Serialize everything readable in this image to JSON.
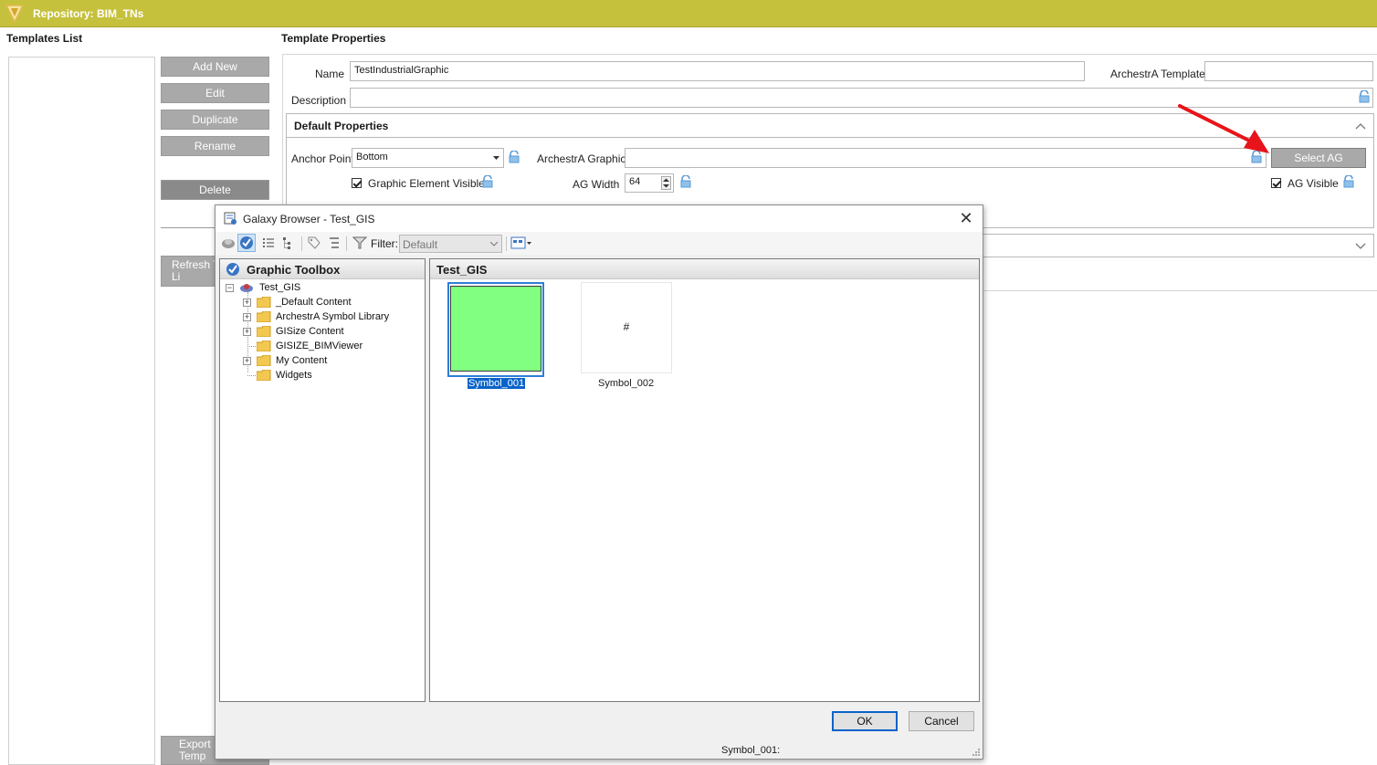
{
  "app": {
    "title": "Repository: BIM_TNs"
  },
  "templates_list": {
    "header": "Templates List",
    "buttons": {
      "add_new": "Add New",
      "edit": "Edit",
      "duplicate": "Duplicate",
      "rename": "Rename",
      "delete": "Delete",
      "refresh": "Refresh T\nLi",
      "export": "Export S\nTemp"
    }
  },
  "template_properties": {
    "header": "Template Properties",
    "name_label": "Name",
    "name_value": "TestIndustrialGraphic",
    "archestra_template_label": "ArchestrA Template",
    "archestra_template_value": "",
    "description_label": "Description",
    "description_value": "",
    "default_properties": {
      "header": "Default Properties",
      "anchor_point_label": "Anchor Point",
      "anchor_point_value": "Bottom",
      "archestra_graphic_label": "ArchestrA Graphic",
      "archestra_graphic_value": "",
      "select_ag_label": "Select AG",
      "graphic_element_visible_label": "Graphic Element Visible",
      "graphic_element_visible_checked": true,
      "ag_width_label": "AG Width",
      "ag_width_value": "64",
      "ag_visible_label": "AG Visible",
      "ag_visible_checked": true
    }
  },
  "dialog": {
    "title": "Galaxy Browser - Test_GIS",
    "filter_label": "Filter:",
    "filter_value": "Default",
    "left_pane_header": "Graphic Toolbox",
    "tree": [
      {
        "label": "Test_GIS",
        "level": 0,
        "expandable": true
      },
      {
        "label": "_Default Content",
        "level": 1,
        "expandable": true
      },
      {
        "label": "ArchestrA Symbol Library",
        "level": 1,
        "expandable": true
      },
      {
        "label": "GISize Content",
        "level": 1,
        "expandable": true
      },
      {
        "label": "GISIZE_BIMViewer",
        "level": 1,
        "expandable": false
      },
      {
        "label": "My Content",
        "level": 1,
        "expandable": true
      },
      {
        "label": "Widgets",
        "level": 1,
        "expandable": false
      }
    ],
    "right_pane_header": "Test_GIS",
    "symbols": [
      {
        "label": "Symbol_001",
        "selected": true,
        "thumb": ""
      },
      {
        "label": "Symbol_002",
        "selected": false,
        "thumb": "#"
      }
    ],
    "ok_label": "OK",
    "cancel_label": "Cancel",
    "status_text": "Symbol_001:"
  },
  "colors": {
    "title_bar": "#c6c13d",
    "button_gray": "#a9a9a9",
    "selection_blue": "#0a63c9",
    "symbol_green": "#80ff80",
    "arrow_red": "#e8141b"
  },
  "icons": [
    "app-logo-icon",
    "lock-icon",
    "dropdown-arrow-icon",
    "spinner-icon",
    "collapse-chevron-icon",
    "expand-chevron-icon",
    "galaxy-browser-icon",
    "close-icon",
    "galaxy-icon",
    "check-graphic-icon",
    "list-view-icon",
    "tree-view-icon",
    "tag-icon",
    "filter-icon",
    "view-mode-icon",
    "folder-icon"
  ]
}
